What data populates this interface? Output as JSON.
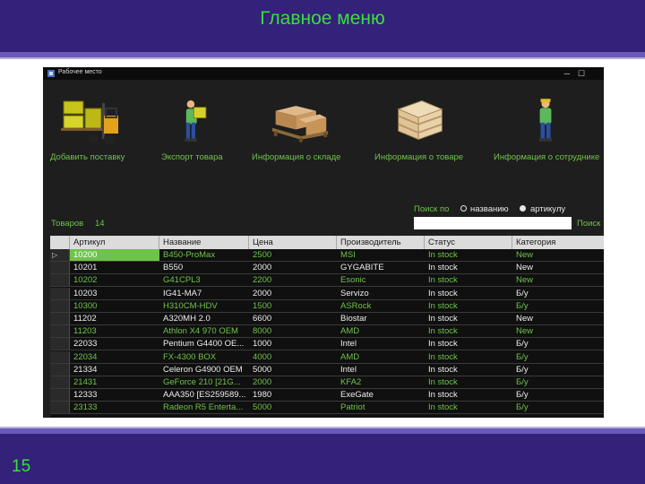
{
  "slide": {
    "title": "Главное меню",
    "page_number": "15"
  },
  "window": {
    "title": "Рабочее место",
    "minimize": "─",
    "maximize": "☐"
  },
  "toolbar": [
    {
      "label": "Добавить поставку",
      "icon": "forklift-icon"
    },
    {
      "label": "Экспорт товара",
      "icon": "worker-carrying-box-icon"
    },
    {
      "label": "Информация о складе",
      "icon": "boxes-on-pallet-icon"
    },
    {
      "label": "Информация о товаре",
      "icon": "wooden-crate-icon"
    },
    {
      "label": "Информация о сотруднике",
      "icon": "worker-icon"
    }
  ],
  "goods_count": {
    "label": "Товаров",
    "value": "14"
  },
  "search": {
    "label": "Поиск по",
    "option_name": "названию",
    "option_article": "артикулу",
    "selected": "названию",
    "value": "",
    "button": "Поиск"
  },
  "table": {
    "columns": [
      "Артикул",
      "Название",
      "Цена",
      "Производитель",
      "Статус",
      "Категория"
    ],
    "rows": [
      {
        "id": "10200",
        "name": "B450-ProMax",
        "price": "2500",
        "maker": "MSI",
        "status": "In stock",
        "category": "New",
        "style": "green",
        "selected": true
      },
      {
        "id": "10201",
        "name": "B550",
        "price": "2000",
        "maker": "GYGABITE",
        "status": "In stock",
        "category": "New",
        "style": "white",
        "selected": false
      },
      {
        "id": "10202",
        "name": "G41CPL3",
        "price": "2200",
        "maker": "Esonic",
        "status": "In stock",
        "category": "New",
        "style": "green",
        "selected": false
      },
      {
        "id": "10203",
        "name": "IG41-MA7",
        "price": "2000",
        "maker": "Servizo",
        "status": "In stock",
        "category": "Б/у",
        "style": "white",
        "selected": false
      },
      {
        "id": "10300",
        "name": "H310CM-HDV",
        "price": "1500",
        "maker": "ASRock",
        "status": "In stock",
        "category": "Б/у",
        "style": "green",
        "selected": false
      },
      {
        "id": "11202",
        "name": "A320MH 2.0",
        "price": "6600",
        "maker": "Biostar",
        "status": "In stock",
        "category": "New",
        "style": "white",
        "selected": false
      },
      {
        "id": "11203",
        "name": "Athlon X4 970 OEM",
        "price": "8000",
        "maker": "AMD",
        "status": "In stock",
        "category": "New",
        "style": "green",
        "selected": false
      },
      {
        "id": "22033",
        "name": "Pentium G4400 OE...",
        "price": "1000",
        "maker": "Intel",
        "status": "In stock",
        "category": "Б/у",
        "style": "white",
        "selected": false
      },
      {
        "id": "22034",
        "name": "FX-4300 BOX",
        "price": "4000",
        "maker": "AMD",
        "status": "In stock",
        "category": "Б/у",
        "style": "green",
        "selected": false
      },
      {
        "id": "21334",
        "name": "Celeron G4900 OEM",
        "price": "5000",
        "maker": "Intel",
        "status": "In stock",
        "category": "Б/у",
        "style": "white",
        "selected": false
      },
      {
        "id": "21431",
        "name": "GeForce 210 [21G...",
        "price": "2000",
        "maker": "KFA2",
        "status": "In stock",
        "category": "Б/у",
        "style": "green",
        "selected": false
      },
      {
        "id": "12333",
        "name": "AAA350 [ES259589...",
        "price": "1980",
        "maker": "ExeGate",
        "status": "In stock",
        "category": "Б/у",
        "style": "white",
        "selected": false
      },
      {
        "id": "23133",
        "name": "Radeon R5 Enterta...",
        "price": "5000",
        "maker": "Patriot",
        "status": "In stock",
        "category": "Б/у",
        "style": "green",
        "selected": false
      }
    ]
  },
  "colors": {
    "accent_green": "#6fc34a",
    "slide_band": "#33217a",
    "window_bg": "#1e1e1e"
  }
}
